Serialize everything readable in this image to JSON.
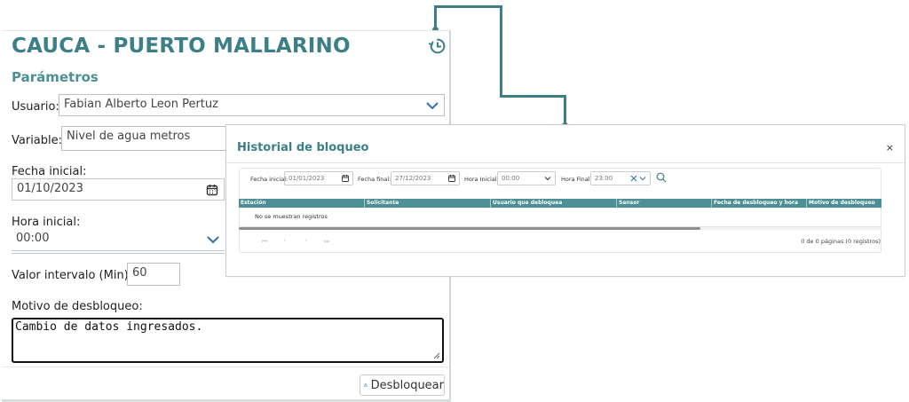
{
  "left_panel": {
    "title": "CAUCA - PUERTO MALLARINO",
    "section_title": "Parámetros",
    "usuario": {
      "label": "Usuario:",
      "value": "Fabian Alberto Leon Pertuz"
    },
    "variable": {
      "label": "Variable:",
      "value": "Nivel de agua metros"
    },
    "fecha_inicial": {
      "label": "Fecha inicial:",
      "value": "01/10/2023"
    },
    "hora_inicial": {
      "label": "Hora inicial:",
      "value": "00:00"
    },
    "valor_intervalo": {
      "label": "Valor intervalo (Min):",
      "value": "60"
    },
    "motivo": {
      "label": "Motivo de desbloqueo:",
      "value": "Cambio de datos ingresados."
    },
    "unlock_button": "Desbloquear"
  },
  "modal": {
    "title": "Historial de bloqueo",
    "close": "×",
    "filters": {
      "fecha_inicial_label": "Fecha inicial:",
      "fecha_inicial": "01/01/2023",
      "fecha_final_label": "Fecha final:",
      "fecha_final": "27/12/2023",
      "hora_inicial_label": "Hora Inicial:",
      "hora_inicial": "00:00",
      "hora_final_label": "Hora Final:",
      "hora_final": "23:00"
    },
    "columns": [
      "Estación",
      "Solicitante",
      "Usuario que debloquea",
      "Sensor",
      "Fecha de desbloqueo y hora",
      "Motivo de desbloqueo"
    ],
    "empty_message": "No se muestran registros",
    "pager": {
      "first": "⏮",
      "prev": "‹",
      "next": "›",
      "last": "⏭"
    },
    "page_info": "0 de 0 páginas (0 registros)"
  },
  "colors": {
    "accent": "#3c7f86",
    "header": "#4c8f95"
  }
}
